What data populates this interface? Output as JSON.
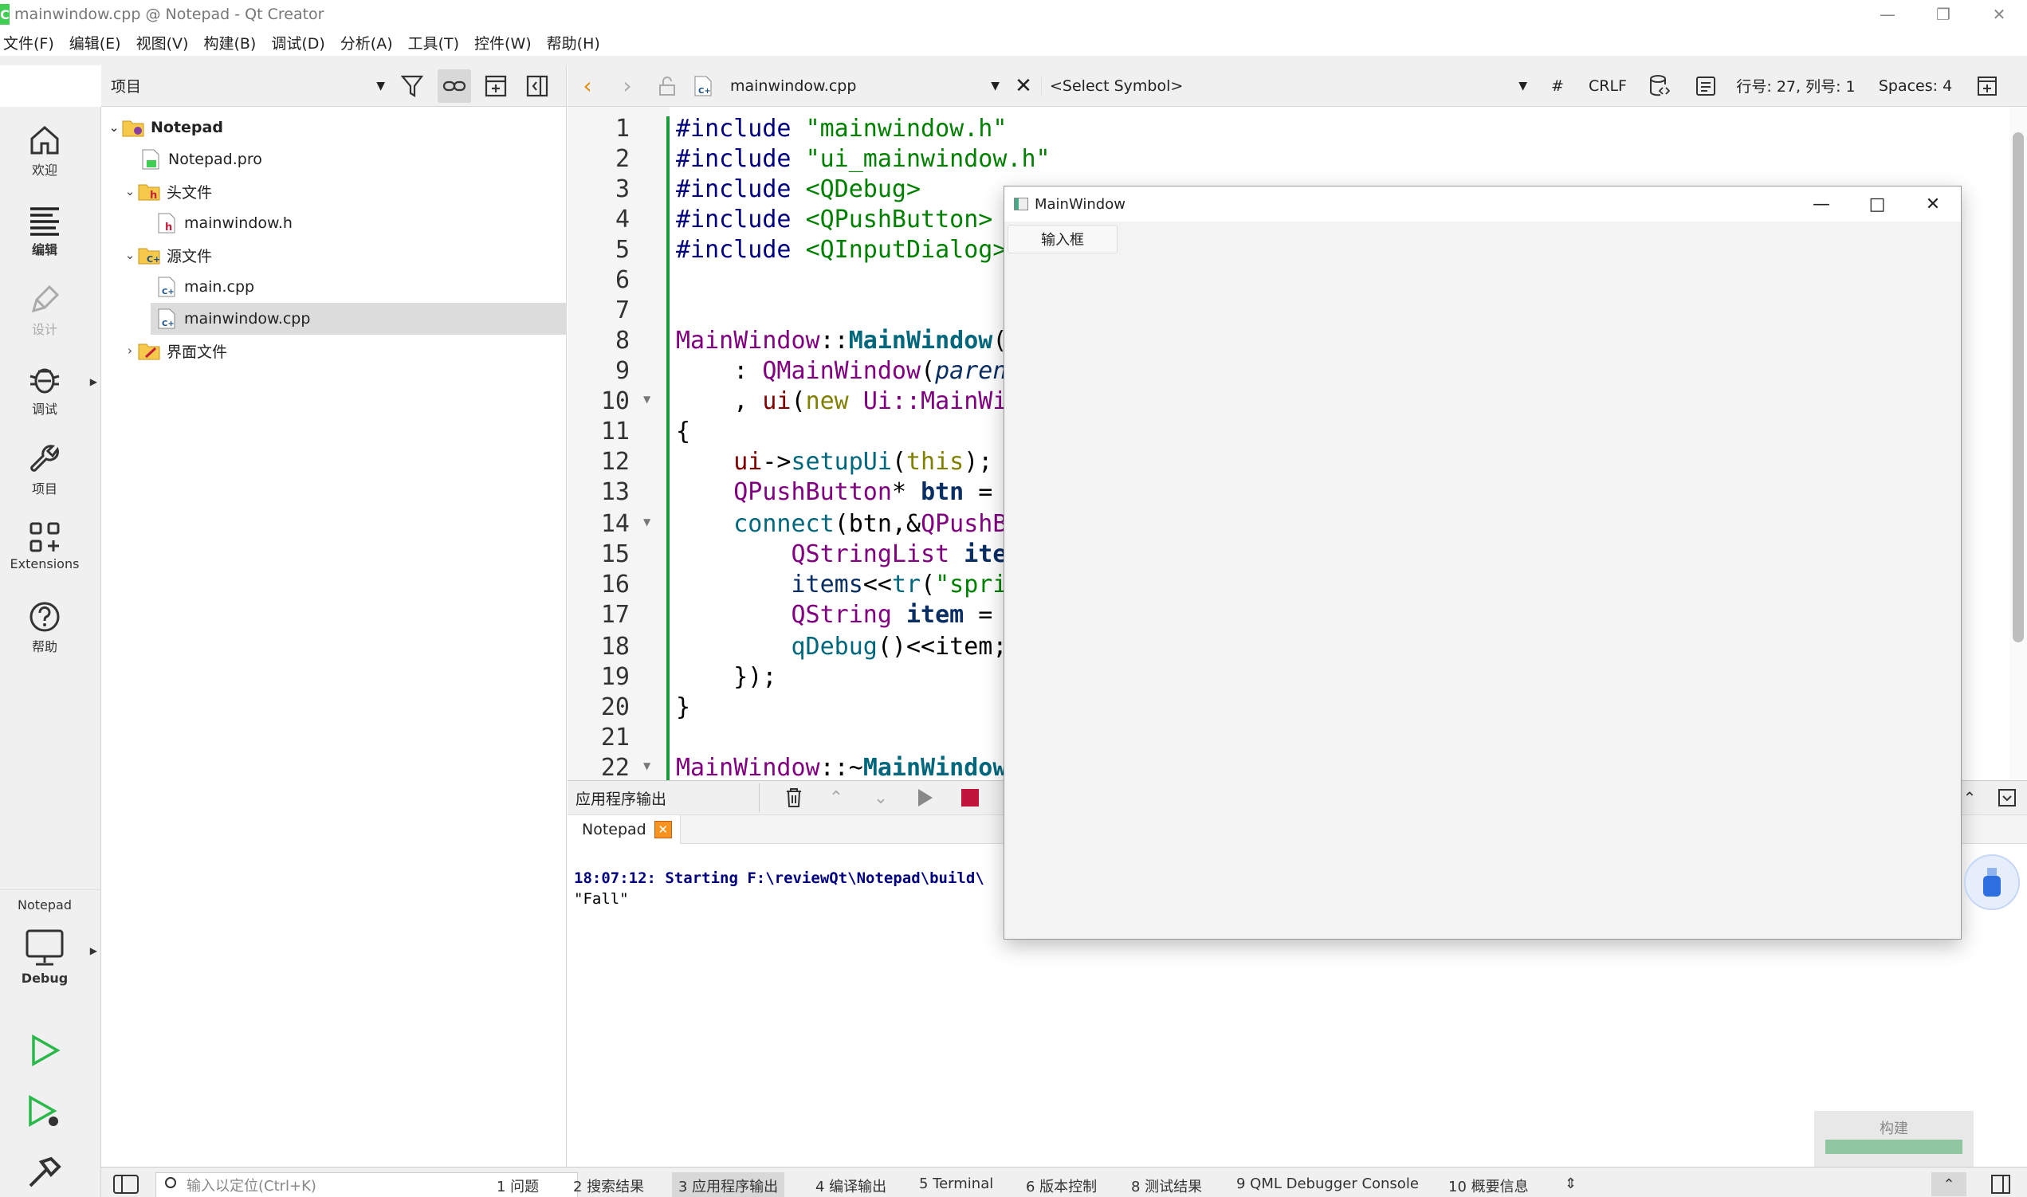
{
  "window": {
    "title": "mainwindow.cpp @ Notepad - Qt Creator",
    "app_icon_letter": "C"
  },
  "menu": [
    "文件(F)",
    "编辑(E)",
    "视图(V)",
    "构建(B)",
    "调试(D)",
    "分析(A)",
    "工具(T)",
    "控件(W)",
    "帮助(H)"
  ],
  "modes": {
    "welcome": "欢迎",
    "edit": "编辑",
    "design": "设计",
    "debug": "调试",
    "projects": "项目",
    "extensions": "Extensions",
    "help": "帮助"
  },
  "kit": {
    "project": "Notepad",
    "config": "Debug"
  },
  "project_panel": {
    "combo_label": "项目"
  },
  "tree": {
    "root": "Notepad",
    "pro": "Notepad.pro",
    "headers": "头文件",
    "header_file": "mainwindow.h",
    "sources": "源文件",
    "src_main": "main.cpp",
    "src_mainwindow": "mainwindow.cpp",
    "forms": "界面文件"
  },
  "editor_toolbar": {
    "file": "mainwindow.cpp",
    "symbol": "<Select Symbol>",
    "hash": "#",
    "line_ending": "CRLF",
    "position": "行号: 27, 列号: 1",
    "indent": "Spaces: 4"
  },
  "line_numbers": [
    "1",
    "2",
    "3",
    "4",
    "5",
    "6",
    "7",
    "8",
    "9",
    "10",
    "11",
    "12",
    "13",
    "14",
    "15",
    "16",
    "17",
    "18",
    "19",
    "20",
    "21",
    "22"
  ],
  "code": {
    "inc": "#include",
    "l1_str": "\"mainwindow.h\"",
    "l2_str": "\"ui_mainwindow.h\"",
    "l3_str": "<QDebug>",
    "l4_str": "<QPushButton>",
    "l5_str": "<QInputDialog>",
    "l8_cls": "MainWindow",
    "l8_sep": "::",
    "l8_fn": "MainWindow",
    "l8_paren": "(",
    "l9_colon": "    : ",
    "l9_cls": "QMainWindow",
    "l9_paren": "(",
    "l9_param": "paren",
    "l10_comma": "    , ",
    "l10_memb": "ui",
    "l10_paren": "(",
    "l10_kw": "new",
    "l10_sp": " ",
    "l10_cls": "Ui::MainWi",
    "l11": "{",
    "l12_ind": "    ",
    "l12_memb": "ui",
    "l12_arrow": "->",
    "l12_call": "setupUi",
    "l12_paren": "(",
    "l12_kw": "this",
    "l12_end": ");",
    "l13_ind": "    ",
    "l13_cls": "QPushButton",
    "l13_star": "* ",
    "l13_var": "btn",
    "l13_eq": " =",
    "l14_ind": "    ",
    "l14_call": "connect",
    "l14_args": "(btn,&",
    "l14_cls": "QPushB",
    "l15_ind": "        ",
    "l15_cls": "QStringList",
    "l15_sp": " ",
    "l15_var": "ite",
    "l16_ind": "        ",
    "l16_var": "items",
    "l16_op": "<<",
    "l16_call": "tr",
    "l16_paren": "(",
    "l16_str": "\"spri",
    "l17_ind": "        ",
    "l17_cls": "QString",
    "l17_sp": " ",
    "l17_var": "item",
    "l17_eq": " =",
    "l18_ind": "        ",
    "l18_call": "qDebug",
    "l18_rest": "()<<item;",
    "l19": "    });",
    "l20": "}",
    "l22_cls": "MainWindow",
    "l22_sep": "::~",
    "l22_fn": "MainWindow"
  },
  "output": {
    "title": "应用程序输出",
    "tab": "Notepad",
    "line1": "18:07:12: Starting F:\\reviewQt\\Notepad\\build\\",
    "line2": "\"Fall\""
  },
  "build_box": {
    "label": "构建",
    "progress": 1.0
  },
  "statusbar": {
    "locator_placeholder": "输入以定位(Ctrl+K)",
    "panes": [
      "1 问题",
      "2 搜索结果",
      "3 应用程序输出",
      "4 编译输出",
      "5 Terminal",
      "6 版本控制",
      "8 测试结果",
      "9 QML Debugger Console",
      "10 概要信息"
    ],
    "active_pane": 2
  },
  "mainwindow": {
    "title": "MainWindow",
    "button": "输入框"
  },
  "colors": {
    "accent_green": "#1a9a3a",
    "run_green": "#2bb84a",
    "stop_red": "#c0143c",
    "selection": "#dcdcdc"
  }
}
